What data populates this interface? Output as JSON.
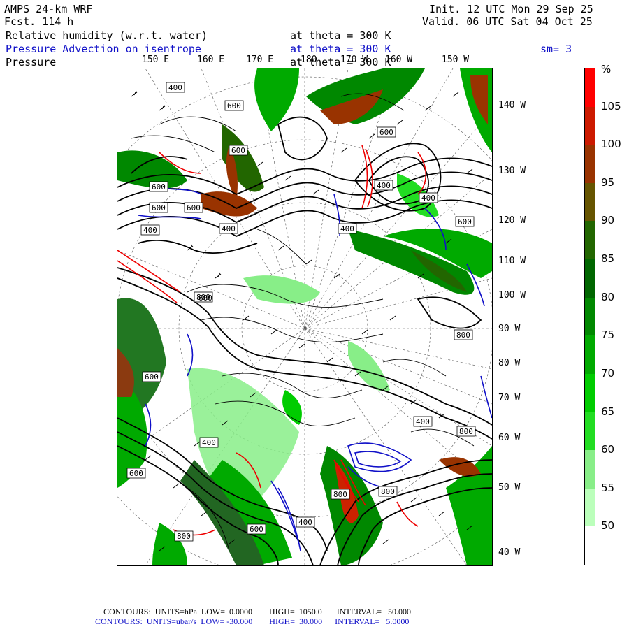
{
  "header": {
    "model": "AMPS 24-km WRF",
    "fcst": "Fcst. 114 h",
    "init": "Init. 12 UTC Mon 29 Sep 25",
    "valid": "Valid. 06 UTC Sat 04 Oct 25",
    "field1": "Relative humidity (w.r.t. water)",
    "field1_level": "at theta = 300 K",
    "field2": "Pressure Advection on isentrope",
    "field2_level": "at theta = 300 K",
    "field2_sm": "sm= 3",
    "field3": "Pressure",
    "field3_level": "at theta = 300 K"
  },
  "lon_labels_top": [
    "150 E",
    "160 E",
    "170 E",
    "180",
    "170 W",
    "160 W",
    "150 W"
  ],
  "lat_labels_right": [
    "140 W",
    "130 W",
    "120 W",
    "110 W",
    "100 W",
    "90 W",
    "80 W",
    "70 W",
    "60 W",
    "50 W",
    "40 W"
  ],
  "colorbar": {
    "unit": "%",
    "labels": [
      "105",
      "100",
      "95",
      "90",
      "85",
      "80",
      "75",
      "70",
      "65",
      "60",
      "55",
      "50"
    ],
    "colors": [
      "#ff0000",
      "#cc1a00",
      "#993300",
      "#665500",
      "#226600",
      "#006600",
      "#008800",
      "#00aa00",
      "#00cc00",
      "#22dd22",
      "#88ee88",
      "#bbffbb",
      "#ffffff"
    ]
  },
  "contour_labels": [
    "400",
    "600",
    "600",
    "600",
    "600",
    "400",
    "600",
    "400",
    "400",
    "600",
    "400",
    "600",
    "400",
    "800",
    "600",
    "400",
    "600",
    "400",
    "800",
    "800",
    "400",
    "800",
    "800",
    "800",
    "600",
    "600"
  ],
  "footer": {
    "line1": "CONTOURS:  UNITS=hPa  LOW=  0.0000        HIGH=  1050.0       INTERVAL=   50.000",
    "line2": "CONTOURS:  UNITS=ubar/s  LOW= -30.000        HIGH=  30.000      INTERVAL=   5.0000"
  }
}
